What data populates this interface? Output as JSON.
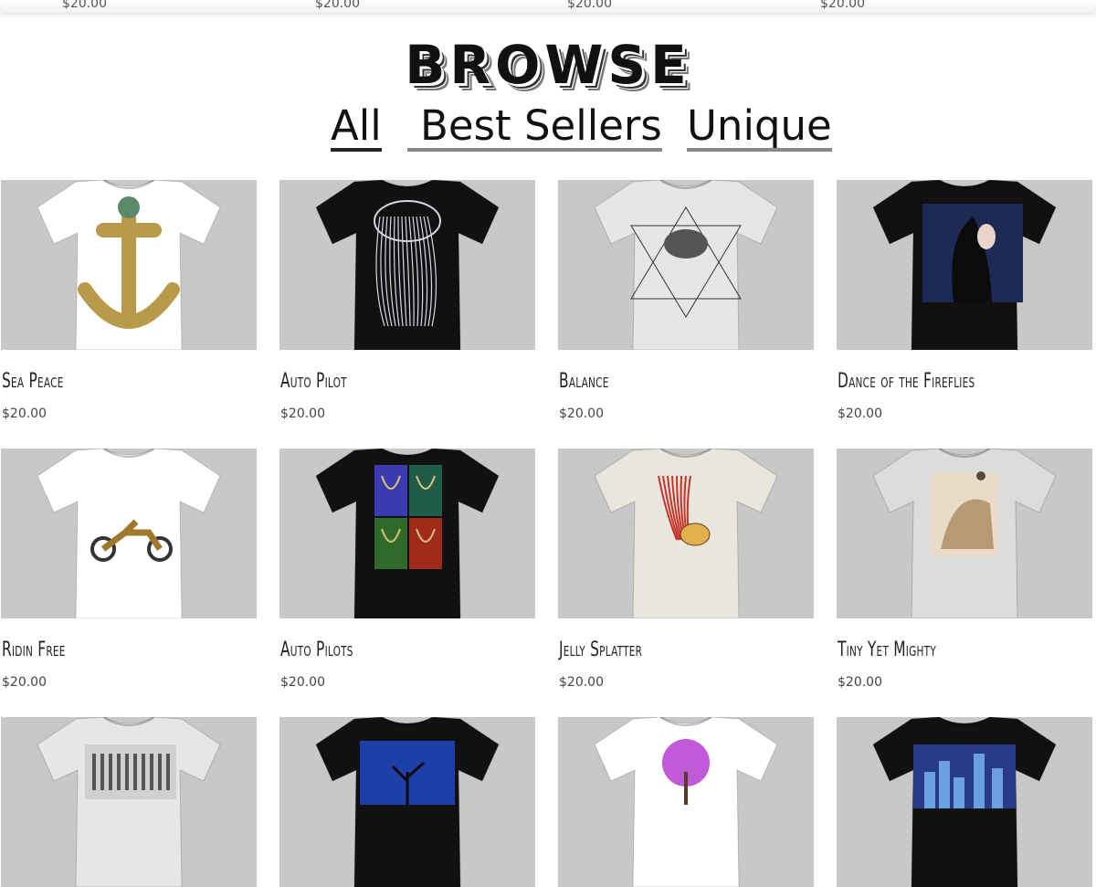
{
  "top_strip": {
    "prices": [
      "$20.00",
      "$20.00",
      "$20.00",
      "$20.00"
    ]
  },
  "heading": {
    "title": "BROWSE",
    "filters": [
      {
        "label": "All"
      },
      {
        "label": "Best Sellers"
      },
      {
        "label": "Unique"
      }
    ]
  },
  "products": [
    {
      "name": "Sea Peace",
      "price": "$20.00",
      "shirt_color": "#ffffff",
      "art_color": "#b89a4a",
      "icon": "anchor-floral-art"
    },
    {
      "name": "Auto Pilot",
      "price": "$20.00",
      "shirt_color": "#111111",
      "art_color": "#d8d8e8",
      "icon": "jellyfish-line-art"
    },
    {
      "name": "Balance",
      "price": "$20.00",
      "shirt_color": "#e6e6e6",
      "art_color": "#333333",
      "icon": "dragon-triangles-art"
    },
    {
      "name": "Dance of the Fireflies",
      "price": "$20.00",
      "shirt_color": "#111111",
      "art_color": "#1d2a55",
      "icon": "elf-girl-art"
    },
    {
      "name": "Ridin Free",
      "price": "$20.00",
      "shirt_color": "#ffffff",
      "art_color": "#a0782e",
      "icon": "chopper-motorcycle-art"
    },
    {
      "name": "Auto Pilots",
      "price": "$20.00",
      "shirt_color": "#111111",
      "art_color": "#3b3bb0",
      "icon": "jellyfish-quad-art"
    },
    {
      "name": "Jelly Splatter",
      "price": "$20.00",
      "shirt_color": "#e9e6dd",
      "art_color": "#c8332b",
      "icon": "jellyfish-splatter-art"
    },
    {
      "name": "Tiny Yet Mighty",
      "price": "$20.00",
      "shirt_color": "#dcdcdc",
      "art_color": "#b79a73",
      "icon": "fox-portrait-art"
    },
    {
      "name": "",
      "price": "",
      "shirt_color": "#e6e6e6",
      "art_color": "#555555",
      "icon": "zebras-art"
    },
    {
      "name": "",
      "price": "",
      "shirt_color": "#111111",
      "art_color": "#1c3fa8",
      "icon": "night-tree-art"
    },
    {
      "name": "",
      "price": "",
      "shirt_color": "#ffffff",
      "art_color": "#c05ad8",
      "icon": "purple-tree-art"
    },
    {
      "name": "",
      "price": "",
      "shirt_color": "#111111",
      "art_color": "#2a3a8a",
      "icon": "city-skyline-art"
    }
  ]
}
